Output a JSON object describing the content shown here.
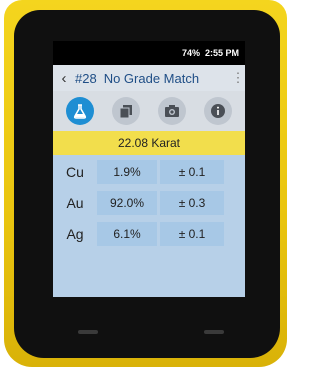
{
  "status": {
    "battery": "74%",
    "time": "2:55 PM"
  },
  "header": {
    "back_icon": "chevron-left-icon",
    "sample_number": "#28",
    "title": "No Grade Match",
    "menu_icon": "kebab-icon"
  },
  "toolbar": {
    "icons": [
      "flask-icon",
      "copy-icon",
      "camera-icon",
      "info-icon"
    ],
    "accent_color": "#1e8ed3"
  },
  "result": {
    "karat": "22.08 Karat",
    "highlight_color": "#f2de4c"
  },
  "elements": [
    {
      "symbol": "Cu",
      "percent": "1.9%",
      "error": "± 0.1"
    },
    {
      "symbol": "Au",
      "percent": "92.0%",
      "error": "± 0.3"
    },
    {
      "symbol": "Ag",
      "percent": "6.1%",
      "error": "± 0.1"
    }
  ],
  "device": {
    "case_color": "#f4d51e"
  }
}
